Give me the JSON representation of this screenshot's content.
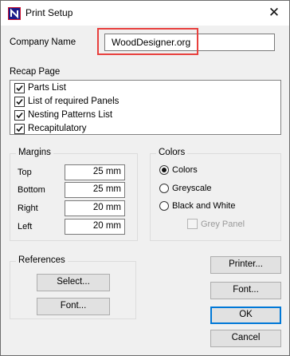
{
  "window": {
    "title": "Print Setup",
    "close_glyph": "✕"
  },
  "company": {
    "label": "Company Name",
    "value": "WoodDesigner.org"
  },
  "recap": {
    "label": "Recap Page",
    "items": [
      {
        "label": "Parts List",
        "checked": true
      },
      {
        "label": "List of required Panels",
        "checked": true
      },
      {
        "label": "Nesting Patterns List",
        "checked": true
      },
      {
        "label": "Recapitulatory",
        "checked": true
      }
    ]
  },
  "margins": {
    "label": "Margins",
    "rows": [
      {
        "label": "Top",
        "value": "25 mm"
      },
      {
        "label": "Bottom",
        "value": "25 mm"
      },
      {
        "label": "Right",
        "value": "20 mm"
      },
      {
        "label": "Left",
        "value": "20 mm"
      }
    ]
  },
  "colors": {
    "label": "Colors",
    "options": [
      {
        "label": "Colors",
        "selected": true
      },
      {
        "label": "Greyscale",
        "selected": false
      },
      {
        "label": "Black and White",
        "selected": false
      }
    ],
    "grey_panel": {
      "label": "Grey Panel",
      "checked": false,
      "enabled": false
    }
  },
  "references": {
    "label": "References",
    "select_button": "Select...",
    "font_button": "Font..."
  },
  "buttons": {
    "printer": "Printer...",
    "font": "Font...",
    "ok": "OK",
    "cancel": "Cancel"
  },
  "accent_colors": {
    "highlight": "#e8403d",
    "default_button": "#0078d7"
  }
}
